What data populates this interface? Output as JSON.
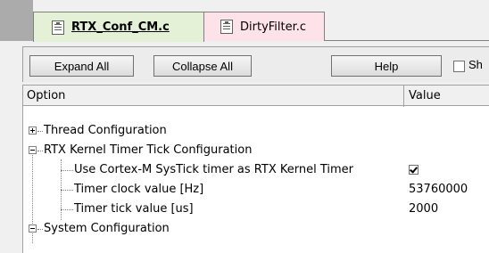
{
  "tabs": [
    {
      "label": "RTX_Conf_CM.c",
      "active": true,
      "color": "#e4f1d6"
    },
    {
      "label": "DirtyFilter.c",
      "active": false,
      "color": "#fde2ea"
    }
  ],
  "toolbar": {
    "expand_label": "Expand All",
    "collapse_label": "Collapse All",
    "help_label": "Help",
    "show_label": "Sh"
  },
  "grid": {
    "columns": [
      "Option",
      "Value"
    ],
    "rows": [
      {
        "label": "Thread Configuration",
        "value": "",
        "level": 0,
        "expander": "plus"
      },
      {
        "label": "RTX Kernel Timer Tick Configuration",
        "value": "",
        "level": 0,
        "expander": "minus"
      },
      {
        "label": "Use Cortex-M SysTick timer as RTX Kernel Timer",
        "value": "checked",
        "level": 1
      },
      {
        "label": "Timer clock value [Hz]",
        "value": "53760000",
        "level": 1
      },
      {
        "label": "Timer tick value [us]",
        "value": "2000",
        "level": 1
      },
      {
        "label": "System Configuration",
        "value": "",
        "level": 0,
        "expander": "minus"
      }
    ]
  }
}
